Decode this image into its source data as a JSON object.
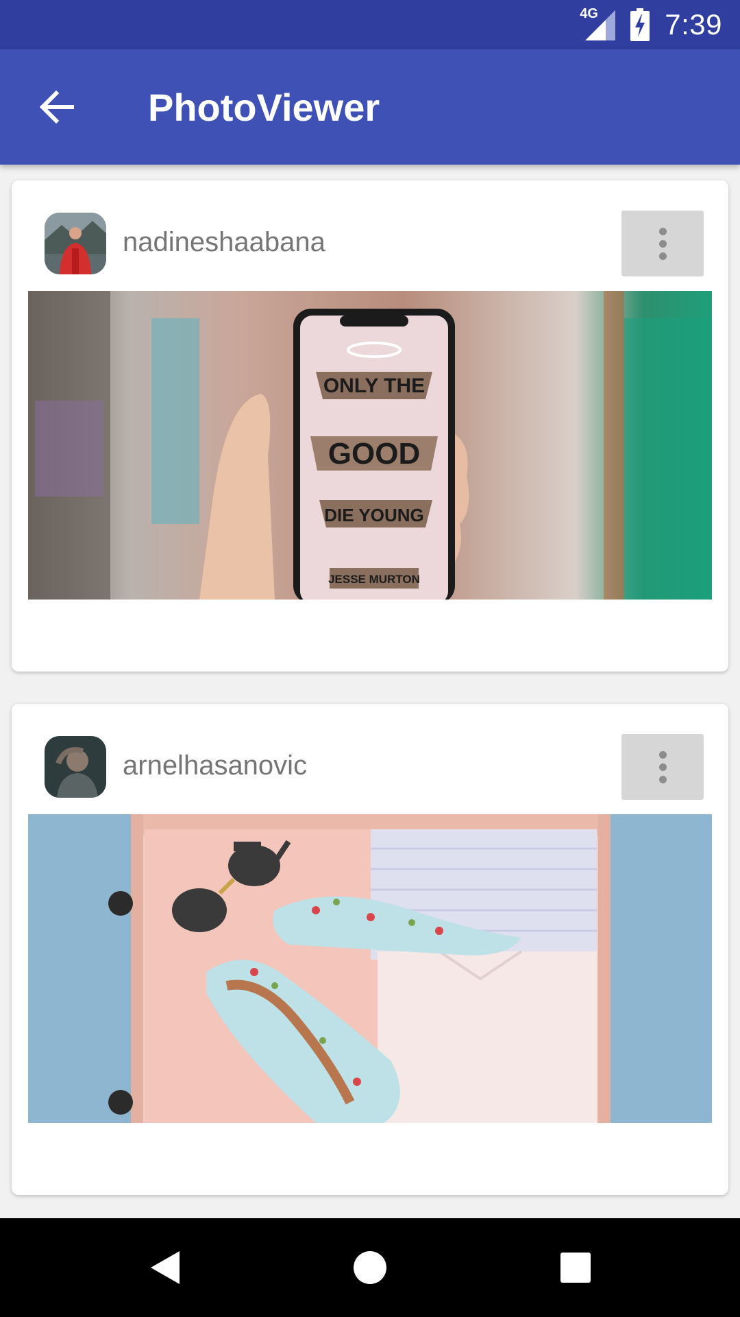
{
  "status_bar": {
    "network": "4G",
    "time": "7:39"
  },
  "app_bar": {
    "title": "PhotoViewer",
    "back_icon": "arrow-back-icon"
  },
  "posts": [
    {
      "username": "nadineshaabana",
      "photo_text": [
        "ONLY THE",
        "GOOD",
        "DIE YOUNG",
        "JESSE MURTON"
      ]
    },
    {
      "username": "arnelhasanovic"
    }
  ],
  "colors": {
    "status_bar": "#303f9f",
    "app_bar": "#3f51b5",
    "more_button": "#d6d6d6"
  }
}
